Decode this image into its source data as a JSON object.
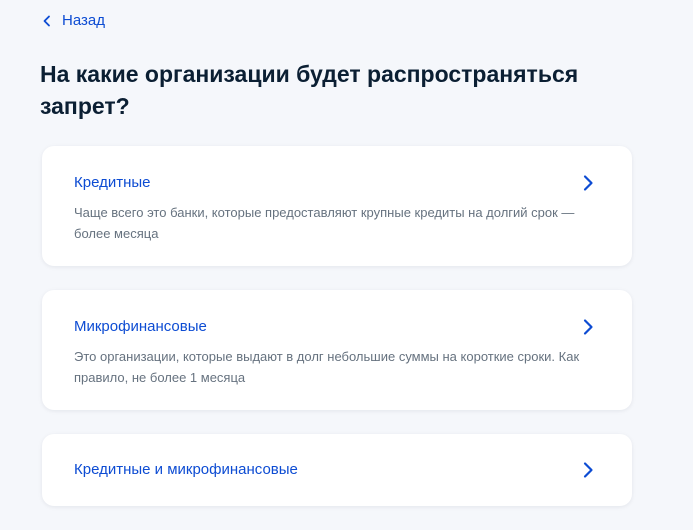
{
  "back": {
    "label": "Назад"
  },
  "page": {
    "title": "На какие организации будет распространяться запрет?"
  },
  "options": [
    {
      "title": "Кредитные",
      "description": "Чаще всего это банки, которые предоставляют крупные кредиты на долгий срок — более месяца"
    },
    {
      "title": "Микрофинансовые",
      "description": "Это организации, которые выдают в долг небольшие суммы на короткие сроки. Как правило, не более 1 месяца"
    },
    {
      "title": "Кредитные и микрофинансовые"
    }
  ],
  "colors": {
    "accent": "#0d4cd3",
    "title": "#0b1f33",
    "muted": "#66727f",
    "background": "#f5f7fb",
    "card": "#ffffff"
  },
  "icons": {
    "back": "chevron-left-icon",
    "option": "chevron-right-icon"
  }
}
